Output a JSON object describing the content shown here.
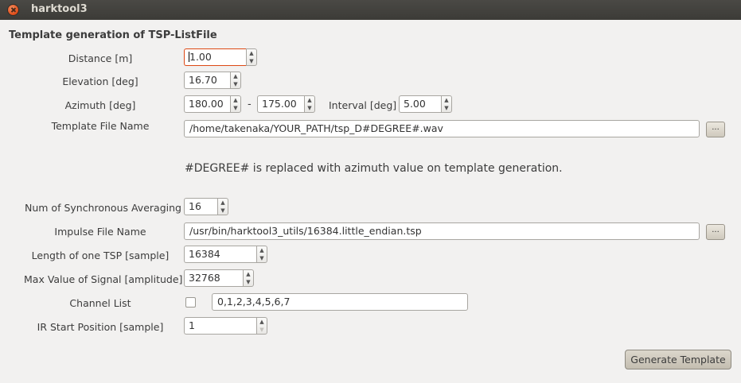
{
  "window": {
    "title": "harktool3"
  },
  "section_title": "Template generation of TSP-ListFile",
  "fields": {
    "distance": {
      "label": "Distance [m]",
      "value": "1.00"
    },
    "elevation": {
      "label": "Elevation [deg]",
      "value": "16.70"
    },
    "azimuth": {
      "label": "Azimuth [deg]",
      "from": "180.00",
      "separator": "-",
      "to": "175.00"
    },
    "interval": {
      "label": "Interval [deg]",
      "value": "5.00"
    },
    "template_file": {
      "label": "Template File Name",
      "value": "/home/takenaka/YOUR_PATH/tsp_D#DEGREE#.wav"
    },
    "note": "#DEGREE# is replaced with azimuth value on template generation.",
    "sync_avg": {
      "label": "Num of Synchronous Averaging",
      "value": "16"
    },
    "impulse_file": {
      "label": "Impulse File Name",
      "value": "/usr/bin/harktool3_utils/16384.little_endian.tsp"
    },
    "tsp_length": {
      "label": "Length of one TSP [sample]",
      "value": "16384"
    },
    "max_signal": {
      "label": "Max Value of Signal [amplitude]",
      "value": "32768"
    },
    "channel_list": {
      "label": "Channel List",
      "value": "0,1,2,3,4,5,6,7",
      "checked": false
    },
    "ir_start": {
      "label": "IR Start Position [sample]",
      "value": "1"
    }
  },
  "browse_label": "...",
  "spin_up": "▲",
  "spin_down": "▼",
  "generate_button": "Generate Template"
}
